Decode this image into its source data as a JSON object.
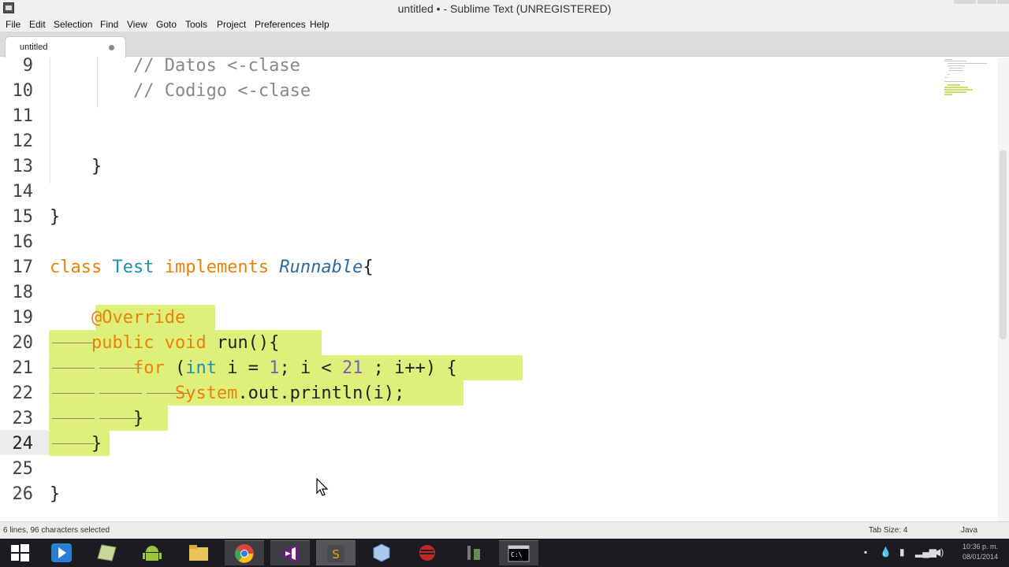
{
  "window": {
    "title": "untitled • - Sublime Text (UNREGISTERED)"
  },
  "menu": {
    "items": [
      "File",
      "Edit",
      "Selection",
      "Find",
      "View",
      "Goto",
      "Tools",
      "Project",
      "Preferences",
      "Help"
    ]
  },
  "tabs": [
    {
      "label": "untitled",
      "modified": true
    }
  ],
  "editor": {
    "language": "Java",
    "current_line": 24,
    "lines": [
      {
        "num": "9",
        "text": "        // Datos <-clase"
      },
      {
        "num": "10",
        "text": "        // Codigo <-clase"
      },
      {
        "num": "11",
        "text": ""
      },
      {
        "num": "12",
        "text": ""
      },
      {
        "num": "13",
        "text": "    }"
      },
      {
        "num": "14",
        "text": ""
      },
      {
        "num": "15",
        "text": "}"
      },
      {
        "num": "16",
        "text": ""
      },
      {
        "num": "17",
        "text": "class Test implements Runnable{"
      },
      {
        "num": "18",
        "text": ""
      },
      {
        "num": "19",
        "text": "    @Override"
      },
      {
        "num": "20",
        "text": "    public void run(){"
      },
      {
        "num": "21",
        "text": "        for (int i = 1; i < 21 ; i++) {"
      },
      {
        "num": "22",
        "text": "            System.out.println(i);"
      },
      {
        "num": "23",
        "text": "        }"
      },
      {
        "num": "24",
        "text": "    }"
      },
      {
        "num": "25",
        "text": ""
      },
      {
        "num": "26",
        "text": "}"
      }
    ]
  },
  "status": {
    "selection": "6 lines, 96 characters selected",
    "tab_size": "Tab Size: 4",
    "syntax": "Java"
  },
  "taskbar": {
    "apps": [
      "start-icon",
      "media-player-icon",
      "notepad-icon",
      "android-icon",
      "file-explorer-icon",
      "chrome-icon",
      "visual-studio-icon",
      "sublime-text-icon",
      "virtualbox-icon",
      "eclipse-icon",
      "tool-icon",
      "command-prompt-icon"
    ],
    "clock_time": "10:36 p. m.",
    "clock_date": "08/01/2014"
  },
  "colors": {
    "selection": "#dff07a",
    "keyword": "#e8820c",
    "type": "#1e8fae",
    "comment": "#888888"
  }
}
